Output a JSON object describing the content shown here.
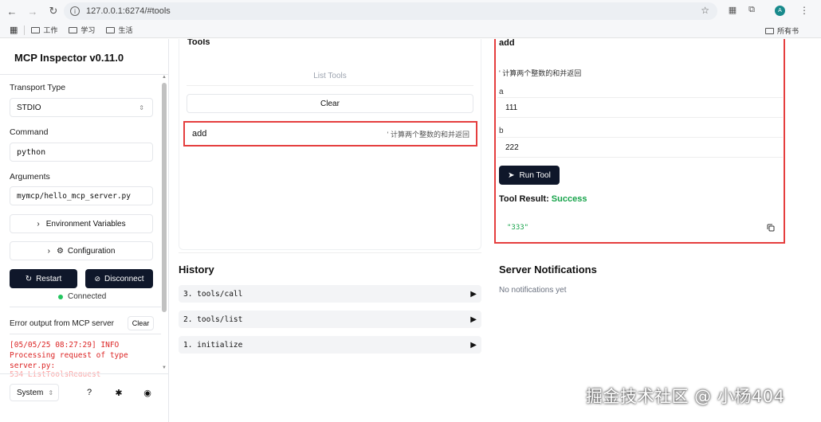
{
  "browser": {
    "url": "127.0.0.1:6274/#tools",
    "bookmarks": [
      "工作",
      "学习",
      "生活"
    ],
    "bookmarks_right": "所有书",
    "avatar_letter": "A"
  },
  "sidebar": {
    "title": "MCP Inspector v0.11.0",
    "transport_label": "Transport Type",
    "transport_value": "STDIO",
    "command_label": "Command",
    "command_value": "python",
    "arguments_label": "Arguments",
    "arguments_value": "mymcp/hello_mcp_server.py",
    "env_button": "Environment Variables",
    "config_button": "Configuration",
    "restart_button": "Restart",
    "disconnect_button": "Disconnect",
    "status": "Connected",
    "error_label": "Error output from MCP server",
    "error_clear": "Clear",
    "error_text": "[05/05/25 08:27:29] INFO Processing request of type server.py:",
    "error_text_cut": "534 ListToolsRequest",
    "theme": "System"
  },
  "tools": {
    "title": "Tools",
    "list_button": "List Tools",
    "clear_button": "Clear",
    "items": [
      {
        "name": "add",
        "description": "' 计算两个整数的和并返回"
      }
    ]
  },
  "detail": {
    "title": "add",
    "description": "' 计算两个整数的和并返回",
    "fields": [
      {
        "label": "a",
        "value": "111"
      },
      {
        "label": "b",
        "value": "222"
      }
    ],
    "run_button": "Run Tool",
    "result_label": "Tool Result:",
    "result_status": "Success",
    "result_value": "\"333\""
  },
  "history": {
    "title": "History",
    "items": [
      "3. tools/call",
      "2. tools/list",
      "1. initialize"
    ]
  },
  "notifications": {
    "title": "Server Notifications",
    "empty": "No notifications yet"
  },
  "watermark": "掘金技术社区 @ 小杨404",
  "colors": {
    "accent_dark": "#0f172a",
    "success": "#16a34a",
    "highlight": "#e53e3e",
    "error": "#dc2626"
  }
}
